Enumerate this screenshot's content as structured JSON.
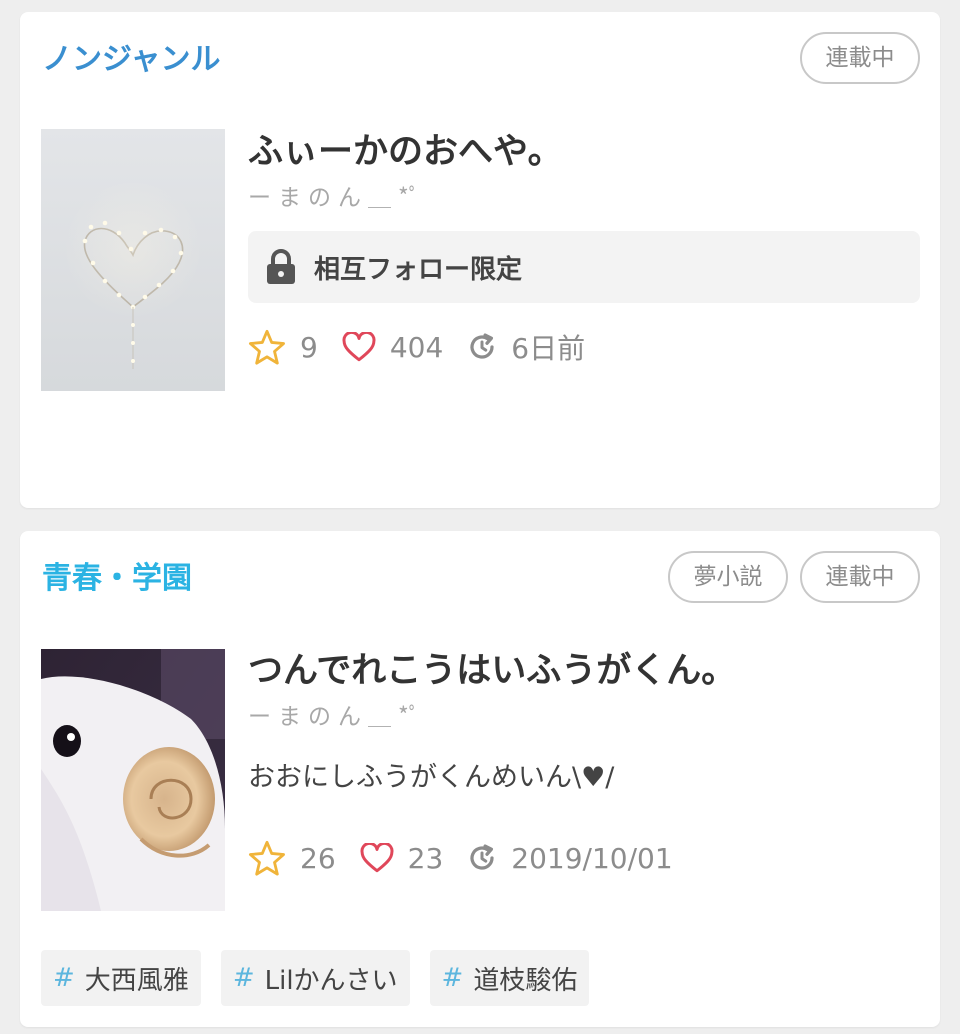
{
  "colors": {
    "genre_blue": "#3a8fd0",
    "genre_cyan": "#2bb3e3",
    "star": "#f0b43a",
    "heart": "#e0475a",
    "hash": "#5cb6de"
  },
  "cards": [
    {
      "genre": "ノンジャンル",
      "badges": [
        "連載中"
      ],
      "title": "ふぃーかのおへや。",
      "author": "ーまのん＿*ﾟ",
      "restriction": "相互フォロー限定",
      "restriction_icon": "lock-icon",
      "stars": "9",
      "likes": "404",
      "updated": "6日前",
      "thumbnail": "heart-lights-image"
    },
    {
      "genre": "青春・学園",
      "badges": [
        "夢小説",
        "連載中"
      ],
      "title": "つんでれこうはいふうがくん。",
      "author": "ーまのん＿*ﾟ",
      "description": "おおにしふうがくんめいん\\♥︎/",
      "stars": "26",
      "likes": "23",
      "updated": "2019/10/01",
      "thumbnail": "sheep-plush-image",
      "tags": [
        "大西風雅",
        "Lilかんさい",
        "道枝駿佑"
      ]
    }
  ]
}
